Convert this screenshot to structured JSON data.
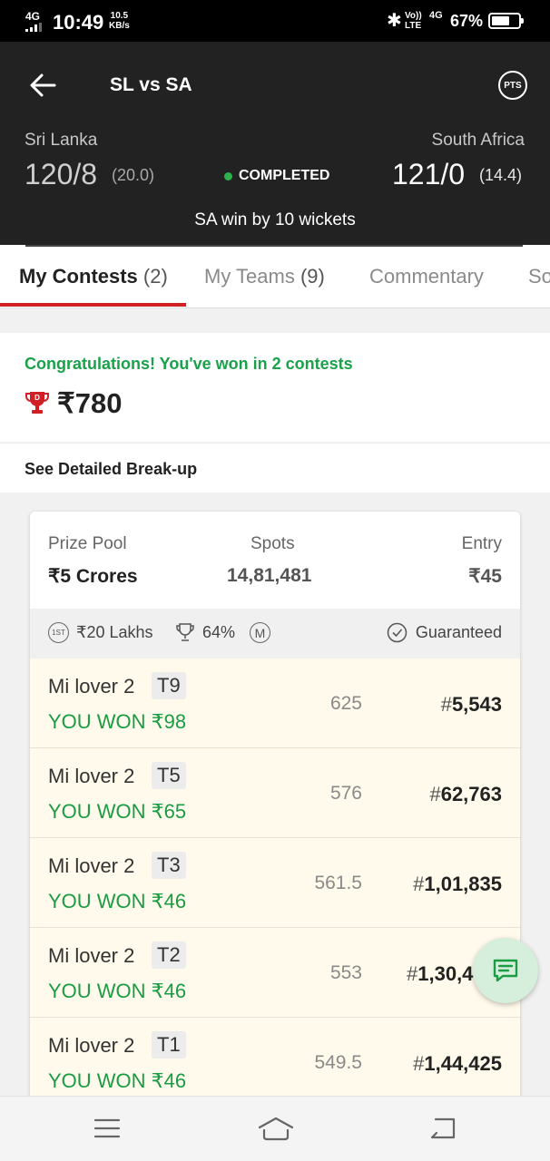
{
  "status_bar": {
    "net_type": "4G",
    "time": "10:49",
    "speed_value": "10.5",
    "speed_unit": "KB/s",
    "volte": "Vo)) LTE",
    "net_type_2": "4G",
    "battery": "67%",
    "battery_level": 0.67
  },
  "header": {
    "title": "SL vs SA",
    "pts_label": "PTS",
    "team1": {
      "name": "Sri Lanka",
      "score": "120/8",
      "overs": "(20.0)"
    },
    "team2": {
      "name": "South Africa",
      "score": "121/0",
      "overs": "(14.4)"
    },
    "status": "COMPLETED",
    "result": "SA win by 10 wickets"
  },
  "tabs": [
    {
      "label": "My Contests",
      "count": "(2)"
    },
    {
      "label": "My Teams",
      "count": "(9)"
    },
    {
      "label": "Commentary",
      "count": ""
    },
    {
      "label": "So",
      "count": ""
    }
  ],
  "winnings": {
    "message": "Congratulations! You've won in 2 contests",
    "amount": "₹780",
    "breakup_link": "See Detailed Break-up"
  },
  "contest": {
    "prize_pool_label": "Prize Pool",
    "prize_pool": "₹5 Crores",
    "spots_label": "Spots",
    "spots": "14,81,481",
    "entry_label": "Entry",
    "entry": "₹45",
    "first_prize_badge": "1ST",
    "first_prize": "₹20 Lakhs",
    "win_percent": "64%",
    "multi_badge": "M",
    "guaranteed": "Guaranteed",
    "teams": [
      {
        "user": "Mi lover 2",
        "team": "T9",
        "won": "YOU WON ₹98",
        "points": "625",
        "rank_hash": "#",
        "rank": "5,543"
      },
      {
        "user": "Mi lover 2",
        "team": "T5",
        "won": "YOU WON ₹65",
        "points": "576",
        "rank_hash": "#",
        "rank": "62,763"
      },
      {
        "user": "Mi lover 2",
        "team": "T3",
        "won": "YOU WON ₹46",
        "points": "561.5",
        "rank_hash": "#",
        "rank": "1,01,835"
      },
      {
        "user": "Mi lover 2",
        "team": "T2",
        "won": "YOU WON ₹46",
        "points": "553",
        "rank_hash": "#",
        "rank": "1,30,4"
      },
      {
        "user": "Mi lover 2",
        "team": "T1",
        "won": "YOU WON ₹46",
        "points": "549.5",
        "rank_hash": "#",
        "rank": "1,44,425"
      }
    ]
  },
  "icons": {
    "back": "arrow-left-icon",
    "trophy": "trophy-icon",
    "chat": "chat-icon",
    "menu": "menu-icon",
    "home": "home-icon",
    "nav_back": "back-icon"
  },
  "colors": {
    "accent_red": "#d11f26",
    "success_green": "#1aa14a",
    "header_bg": "#222222",
    "row_bg": "#fffaeb"
  }
}
